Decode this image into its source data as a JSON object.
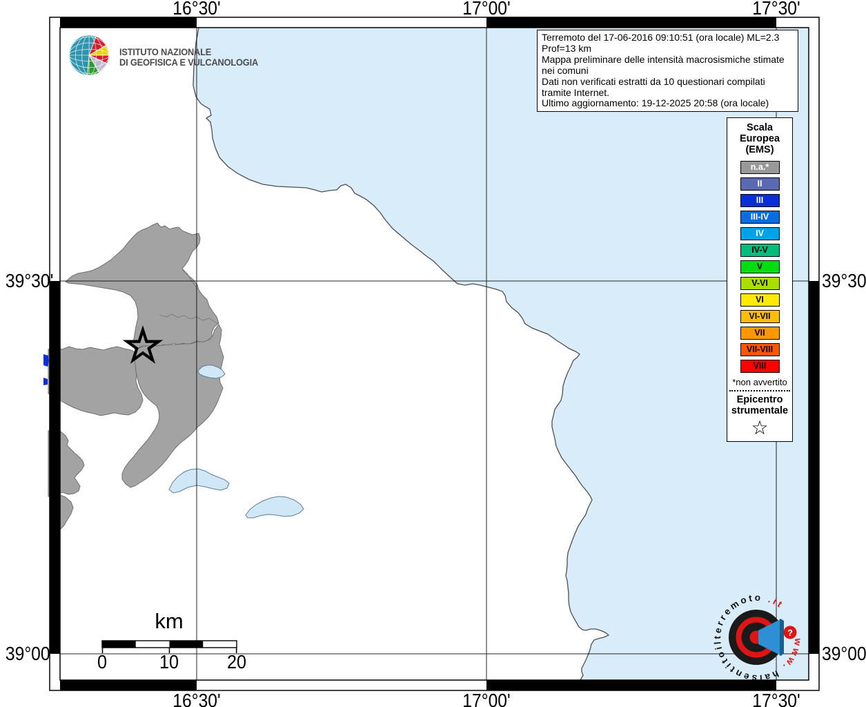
{
  "ingv": {
    "name_line1": "ISTITUTO NAZIONALE",
    "name_line2": "DI GEOFISICA E VULCANOLOGIA"
  },
  "info_box": {
    "line1": "Terremoto del 17-06-2016 09:10:51 (ora locale) ML=2.3 Prof=13 km",
    "line2": "Mappa preliminare delle intensità macrosismiche stimate nei comuni",
    "line3": "Dati non verificati estratti da 10 questionari compilati tramite Internet.",
    "line4": "Ultimo aggiornamento: 19-12-2025 20:58 (ora locale)"
  },
  "axes": {
    "top": [
      "16°30'",
      "17°00'",
      "17°30'"
    ],
    "bottom": [
      "16°30'",
      "17°00'",
      "17°30'"
    ],
    "left": [
      "39°30'",
      "39°00'"
    ],
    "right": [
      "39°30'",
      "39°00'"
    ]
  },
  "legend": {
    "title1": "Scala",
    "title2": "Europea",
    "title3": "(EMS)",
    "items": [
      {
        "label": "n.a.*",
        "bg": "#999999",
        "fg": "#ffffff"
      },
      {
        "label": "II",
        "bg": "#5a69b0",
        "fg": "#ffffff"
      },
      {
        "label": "III",
        "bg": "#0a2fd8",
        "fg": "#ffffff"
      },
      {
        "label": "III-IV",
        "bg": "#0a6ce0",
        "fg": "#ffffff"
      },
      {
        "label": "IV",
        "bg": "#00a2e8",
        "fg": "#ffffff"
      },
      {
        "label": "IV-V",
        "bg": "#00bd7e",
        "fg": "#000000"
      },
      {
        "label": "V",
        "bg": "#00dd11",
        "fg": "#000000"
      },
      {
        "label": "V-VI",
        "bg": "#aade00",
        "fg": "#000000"
      },
      {
        "label": "VI",
        "bg": "#ffea00",
        "fg": "#000000"
      },
      {
        "label": "VI-VII",
        "bg": "#ffbf00",
        "fg": "#000000"
      },
      {
        "label": "VII",
        "bg": "#ff9800",
        "fg": "#000000"
      },
      {
        "label": "VII-VIII",
        "bg": "#ff5500",
        "fg": "#000000"
      },
      {
        "label": "VIII",
        "bg": "#ff0000",
        "fg": "#000000"
      }
    ],
    "footnote": "*non avvertito",
    "epicenter1": "Epicentro",
    "epicenter2": "strumentale",
    "star": "☆"
  },
  "scalebar": {
    "unit": "km",
    "t0": "0",
    "t1": "10",
    "t2": "20"
  },
  "watermark": {
    "pre": "www.",
    "main": "haisentitoilterremoto",
    "post": ".it",
    "question": "?"
  },
  "colors": {
    "sea": "#d9ecf9",
    "lake": "#cfe7f7",
    "lake_border": "#5b7f96",
    "coast": "#4d4d4d",
    "municipality_na": "#a3a3a3",
    "municipality_border": "#6f6f6f",
    "clipped_municipality": "#0a2fd8",
    "frame": "#000000",
    "grid": "#000000",
    "epicenter": "#000000",
    "logo_red": "#dd1515",
    "logo_blue": "#2f8fd4",
    "logo_blue_dark": "#19608f",
    "logo_dark": "#1a1a1a",
    "globe_teal": "#2f95ae"
  }
}
